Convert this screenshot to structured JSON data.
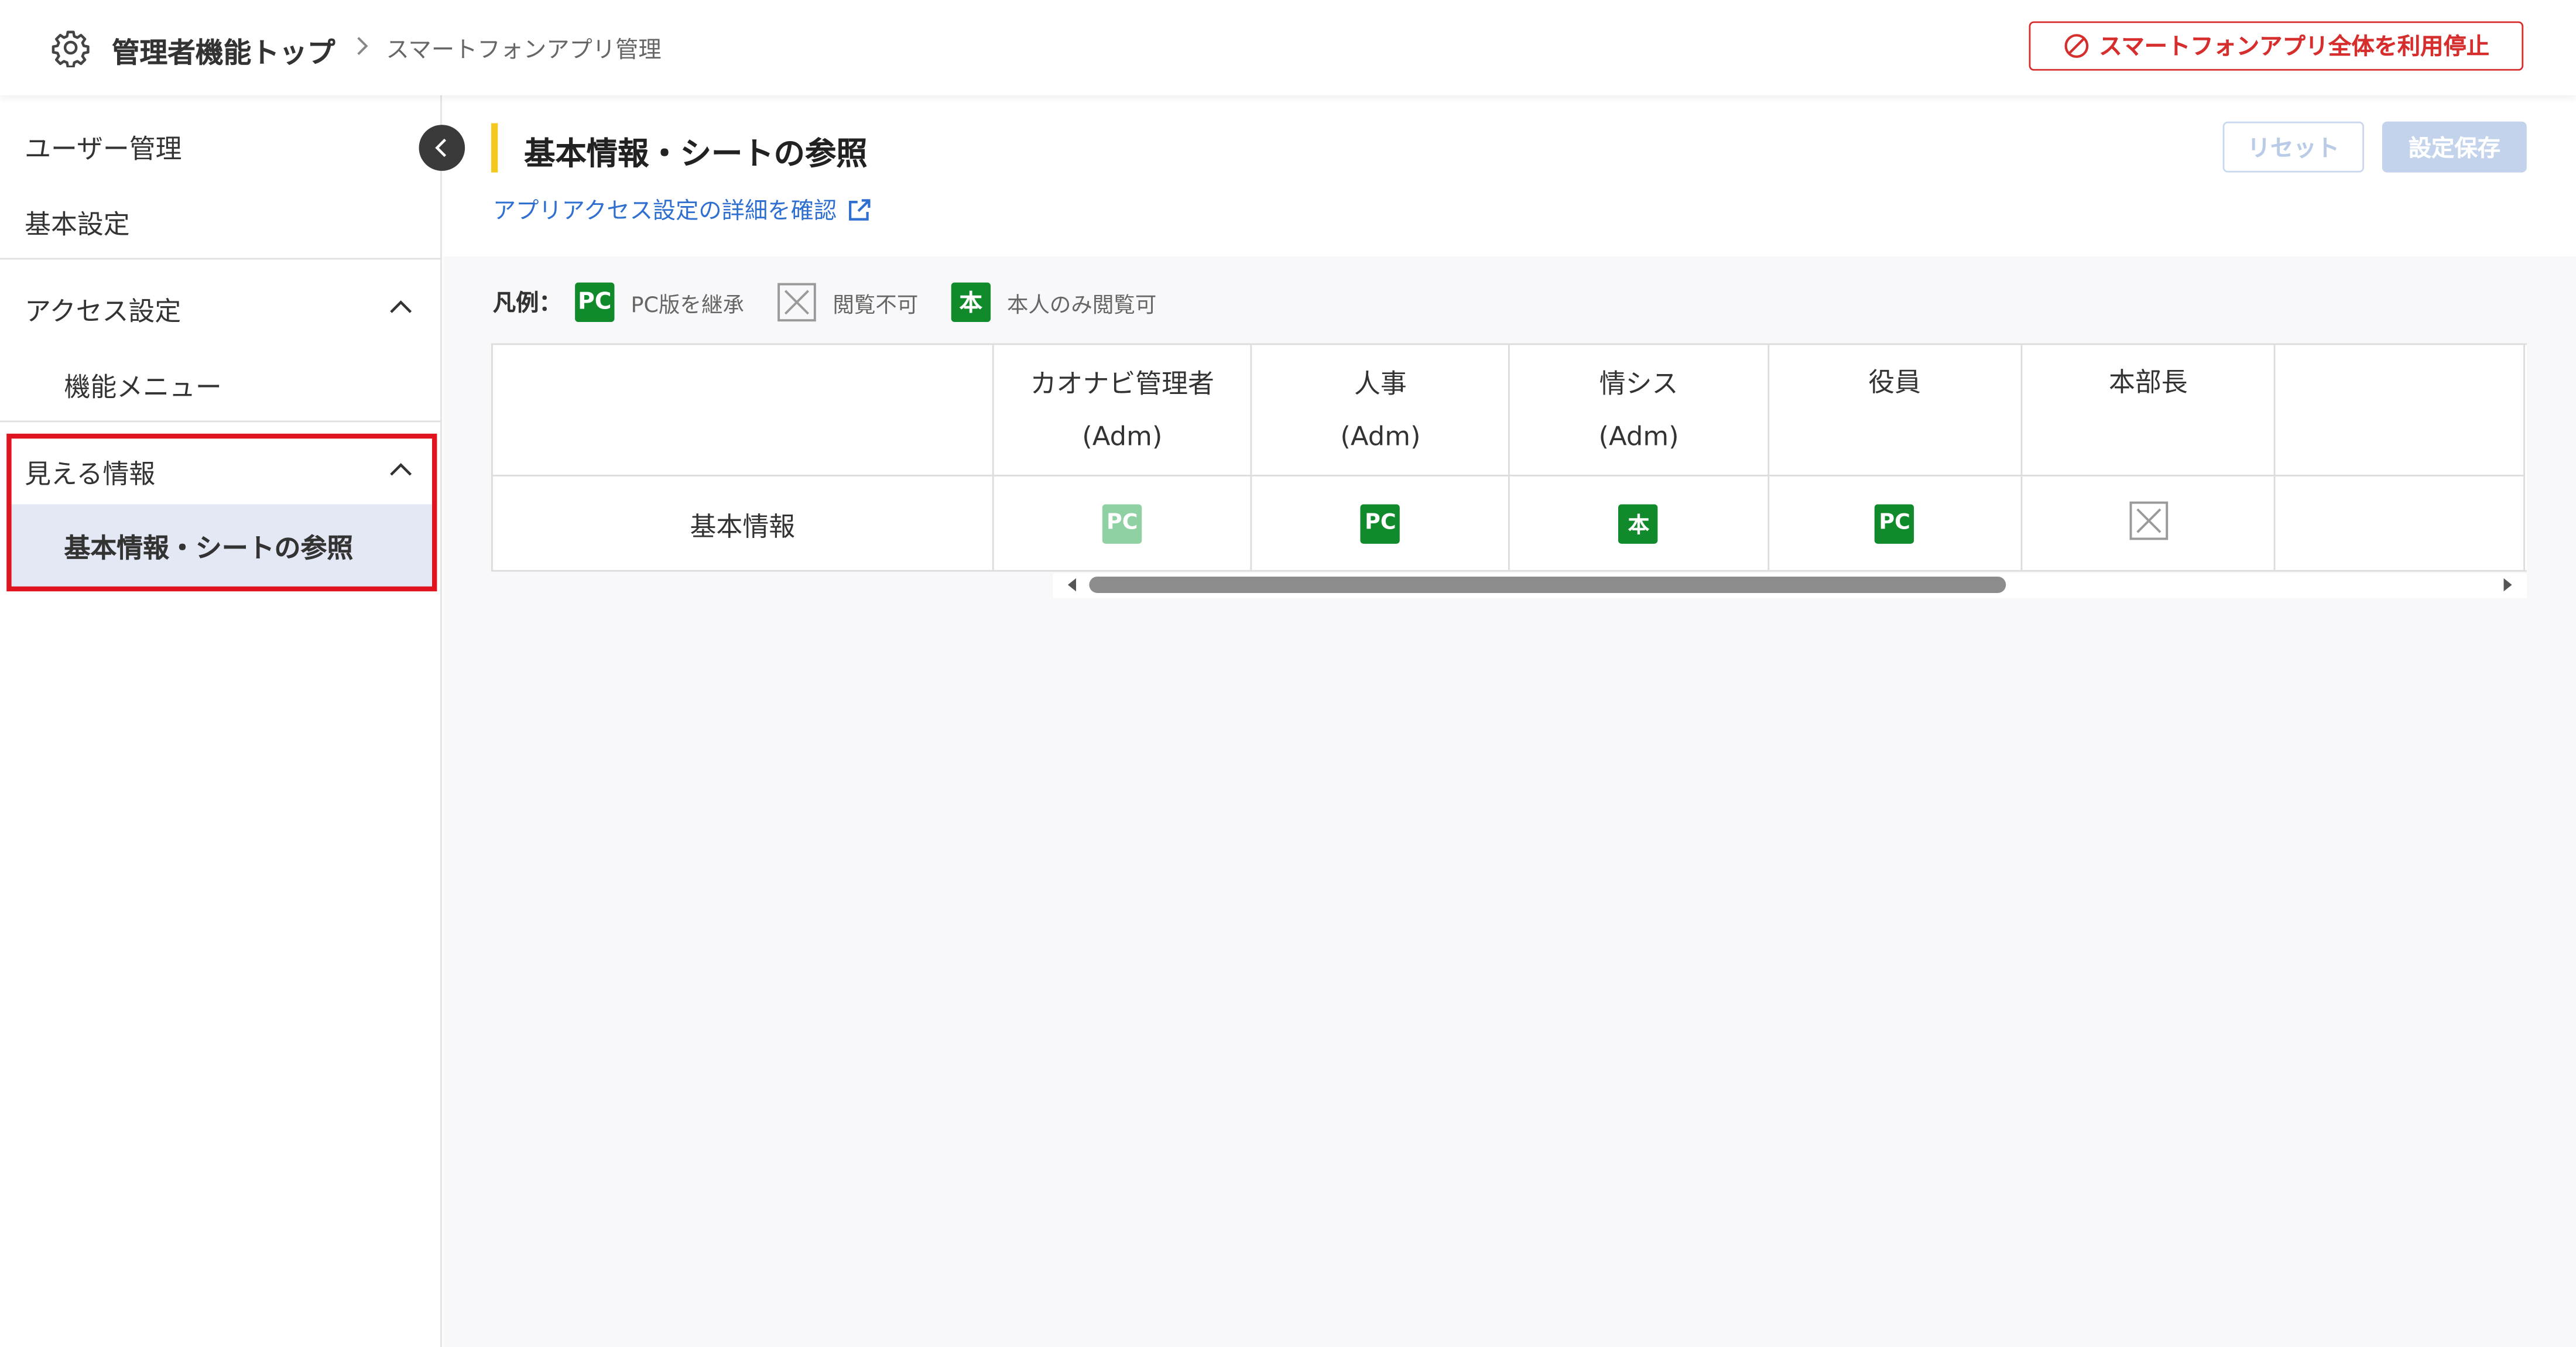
{
  "header": {
    "breadcrumb_top": "管理者機能トップ",
    "breadcrumb_current": "スマートフォンアプリ管理",
    "stop_button_label": "スマートフォンアプリ全体を利用停止"
  },
  "sidebar": {
    "user_management": "ユーザー管理",
    "basic_settings": "基本設定",
    "access_settings": {
      "label": "アクセス設定",
      "items": [
        "機能メニュー"
      ]
    },
    "visible_info": {
      "label": "見える情報",
      "items": [
        "基本情報・シートの参照"
      ]
    }
  },
  "main": {
    "title": "基本情報・シートの参照",
    "detail_link": "アプリアクセス設定の詳細を確認",
    "reset_label": "リセット",
    "save_label": "設定保存"
  },
  "legend": {
    "title": "凡例：",
    "items": [
      {
        "badge": "PC",
        "text": "PC版を継承"
      },
      {
        "badge": "x-box",
        "text": "閲覧不可"
      },
      {
        "badge": "本",
        "text": "本人のみ閲覧可"
      }
    ]
  },
  "table": {
    "columns": [
      {
        "line1": "カオナビ管理者",
        "line2": "(Adm)"
      },
      {
        "line1": "人事",
        "line2": "(Adm)"
      },
      {
        "line1": "情シス",
        "line2": "(Adm)"
      },
      {
        "line1": "役員",
        "line2": ""
      },
      {
        "line1": "本部長",
        "line2": ""
      }
    ],
    "rows": [
      {
        "label": "基本情報",
        "cells": [
          {
            "badge": "PC",
            "state": "faded"
          },
          {
            "badge": "PC",
            "state": "normal"
          },
          {
            "badge": "本",
            "state": "normal"
          },
          {
            "badge": "PC",
            "state": "normal"
          },
          {
            "badge": "x-box",
            "state": "normal"
          }
        ]
      }
    ]
  },
  "colors": {
    "accent_yellow": "#f4c81c",
    "danger_red": "#d62d2d",
    "link_blue": "#2f6fcf",
    "badge_green": "#118a2c",
    "badge_green_faded": "#8fd1a2",
    "active_item_bg": "#e3e8f4",
    "highlight_red": "#e0141e"
  },
  "icons": {
    "gear": "gear-icon",
    "breadcrumb_separator": "chevron-right-icon",
    "stop": "prohibited-icon",
    "collapse": "chevron-left-icon",
    "expand_state": "chevron-up-icon",
    "external_link": "external-link-icon",
    "deny": "x-box-icon"
  }
}
